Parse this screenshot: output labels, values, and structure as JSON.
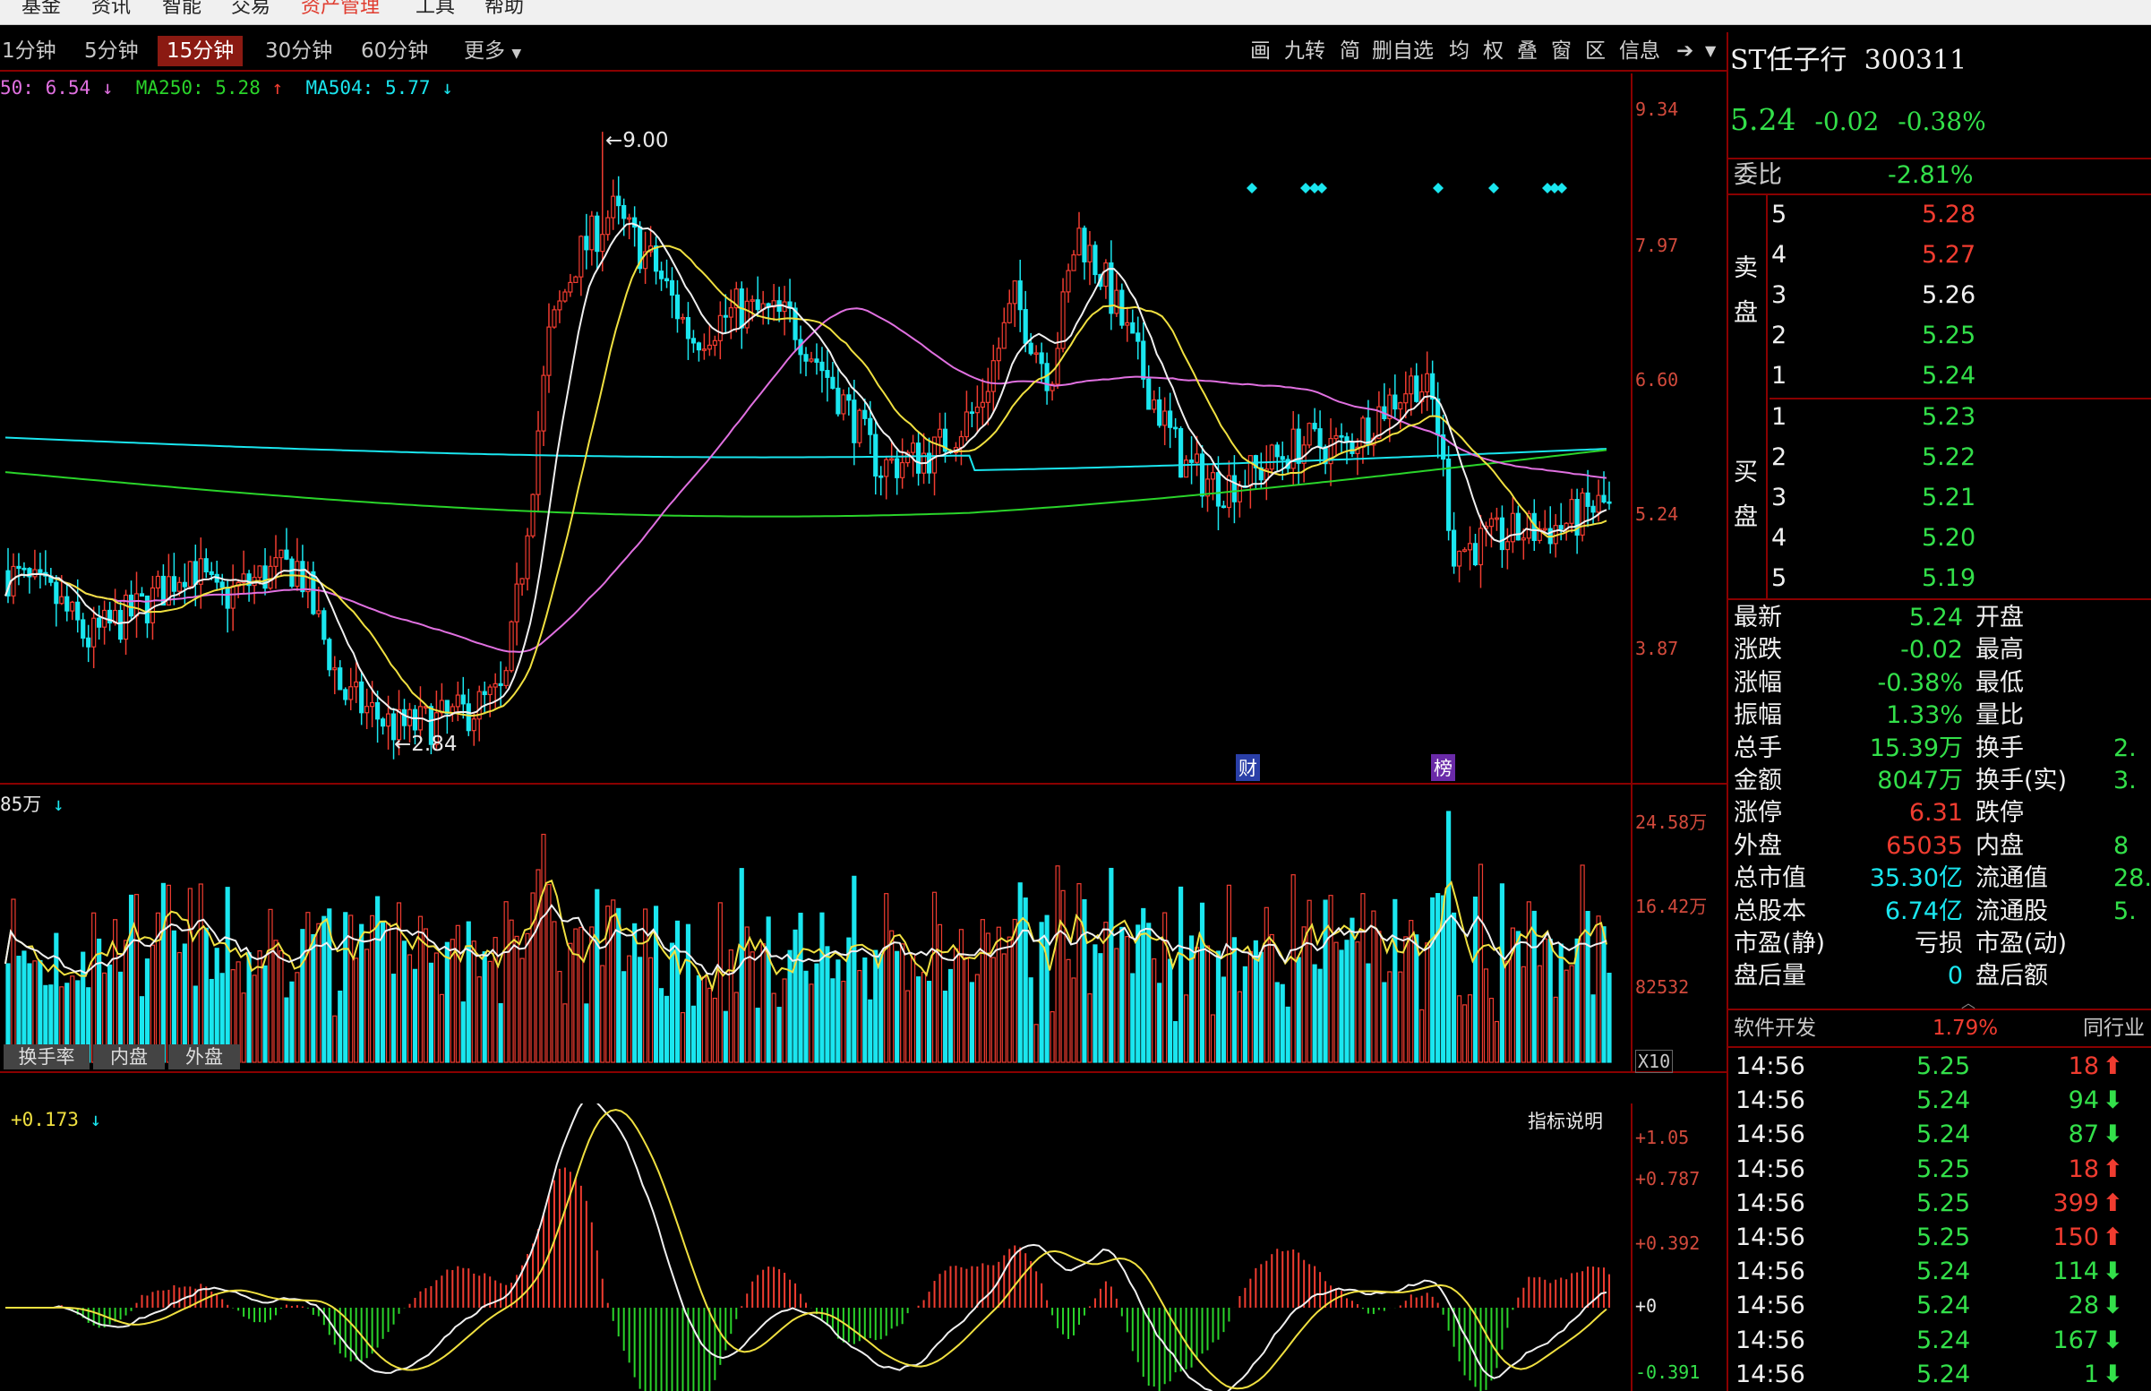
{
  "menu": [
    {
      "label": "基金",
      "active": false
    },
    {
      "label": "资讯",
      "active": false
    },
    {
      "label": "智能",
      "active": false
    },
    {
      "label": "交易",
      "active": false
    },
    {
      "label": "资产管理",
      "active": true
    },
    {
      "label": "工具",
      "active": false
    },
    {
      "label": "帮助",
      "active": false
    }
  ],
  "periods": [
    "1分钟",
    "5分钟",
    "15分钟",
    "30分钟",
    "60分钟",
    "更多"
  ],
  "active_period": "15分钟",
  "tools": [
    "画",
    "九转",
    "简",
    "删自选",
    "均",
    "权",
    "叠",
    "窗",
    "区",
    "信息"
  ],
  "ma_legend": [
    {
      "text": "50: 6.54",
      "arrow": "↓",
      "color": "#e070e0"
    },
    {
      "text": "MA250: 5.28",
      "arrow": "↑",
      "color": "#2ad42a"
    },
    {
      "text": "MA504: 5.77",
      "arrow": "↓",
      "color": "#1ae6ef"
    }
  ],
  "price_axis": [
    "9.34",
    "7.97",
    "6.60",
    "5.24",
    "3.87"
  ],
  "annotations": {
    "high": "9.00",
    "low": "2.84",
    "marker_cai": "财",
    "marker_bang": "榜"
  },
  "volume": {
    "legend": "85万",
    "legend_arrow": "↓",
    "axis": [
      "24.58万",
      "16.42万",
      "82532"
    ],
    "x10": "X10"
  },
  "indicator_tabs": [
    "换手率",
    "内盘",
    "外盘"
  ],
  "indicator": {
    "legend": "+0.173",
    "legend_arrow": "↓",
    "desc_label": "指标说明",
    "axis": [
      "+1.05",
      "+0.787",
      "+0.392",
      "+0",
      "-0.391"
    ]
  },
  "stock": {
    "name": "ST任子行",
    "code": "300311",
    "price": "5.24",
    "change": "-0.02",
    "change_pct": "-0.38%"
  },
  "weibi": {
    "label": "委比",
    "value": "-2.81%"
  },
  "order_book": {
    "sell_label": [
      "卖",
      "盘"
    ],
    "buy_label": [
      "买",
      "盘"
    ],
    "sell": [
      {
        "level": "5",
        "price": "5.28",
        "color": "#f03c30"
      },
      {
        "level": "4",
        "price": "5.27",
        "color": "#f03c30"
      },
      {
        "level": "3",
        "price": "5.26",
        "color": "#f0f0f0"
      },
      {
        "level": "2",
        "price": "5.25",
        "color": "#33e04a"
      },
      {
        "level": "1",
        "price": "5.24",
        "color": "#33e04a"
      }
    ],
    "buy": [
      {
        "level": "1",
        "price": "5.23",
        "color": "#33e04a"
      },
      {
        "level": "2",
        "price": "5.22",
        "color": "#33e04a"
      },
      {
        "level": "3",
        "price": "5.21",
        "color": "#33e04a"
      },
      {
        "level": "4",
        "price": "5.20",
        "color": "#33e04a"
      },
      {
        "level": "5",
        "price": "5.19",
        "color": "#33e04a"
      }
    ]
  },
  "stats": [
    {
      "label": "最新",
      "value": "5.24",
      "color": "#33e04a",
      "label2": "开盘",
      "value2": ""
    },
    {
      "label": "涨跌",
      "value": "-0.02",
      "color": "#33e04a",
      "label2": "最高",
      "value2": ""
    },
    {
      "label": "涨幅",
      "value": "-0.38%",
      "color": "#33e04a",
      "label2": "最低",
      "value2": ""
    },
    {
      "label": "振幅",
      "value": "1.33%",
      "color": "#33e04a",
      "label2": "量比",
      "value2": ""
    },
    {
      "label": "总手",
      "value": "15.39万",
      "color": "#33e04a",
      "label2": "换手",
      "value2": "2."
    },
    {
      "label": "金额",
      "value": "8047万",
      "color": "#33e04a",
      "label2": "换手(实)",
      "value2": "3."
    },
    {
      "label": "涨停",
      "value": "6.31",
      "color": "#f03c30",
      "label2": "跌停",
      "value2": ""
    },
    {
      "label": "外盘",
      "value": "65035",
      "color": "#f03c30",
      "label2": "内盘",
      "value2": "8"
    },
    {
      "label": "总市值",
      "value": "35.30亿",
      "color": "#1ae6ef",
      "label2": "流通值",
      "value2": "28."
    },
    {
      "label": "总股本",
      "value": "6.74亿",
      "color": "#1ae6ef",
      "label2": "流通股",
      "value2": "5."
    },
    {
      "label": "市盈(静)",
      "value": "亏损",
      "color": "#f0f0f0",
      "label2": "市盈(动)",
      "value2": ""
    },
    {
      "label": "盘后量",
      "value": "0",
      "color": "#1ae6ef",
      "label2": "盘后额",
      "value2": ""
    }
  ],
  "industry": {
    "label": "软件开发",
    "pct": "1.79%",
    "peer": "同行业"
  },
  "ticks": [
    {
      "time": "14:56",
      "price": "5.25",
      "vol": "18",
      "dir": "up"
    },
    {
      "time": "14:56",
      "price": "5.24",
      "vol": "94",
      "dir": "down"
    },
    {
      "time": "14:56",
      "price": "5.24",
      "vol": "87",
      "dir": "down"
    },
    {
      "time": "14:56",
      "price": "5.25",
      "vol": "18",
      "dir": "up"
    },
    {
      "time": "14:56",
      "price": "5.25",
      "vol": "399",
      "dir": "up"
    },
    {
      "time": "14:56",
      "price": "5.25",
      "vol": "150",
      "dir": "up"
    },
    {
      "time": "14:56",
      "price": "5.24",
      "vol": "114",
      "dir": "down"
    },
    {
      "time": "14:56",
      "price": "5.24",
      "vol": "28",
      "dir": "down"
    },
    {
      "time": "14:56",
      "price": "5.24",
      "vol": "167",
      "dir": "down"
    },
    {
      "time": "14:56",
      "price": "5.24",
      "vol": "1",
      "dir": "down"
    }
  ],
  "chart_data": {
    "type": "candlestick",
    "price_range": [
      2.84,
      9.34
    ],
    "key_points": [
      {
        "label": "low",
        "value": 2.84
      },
      {
        "label": "high",
        "value": 9.0
      },
      {
        "label": "last",
        "value": 5.24
      }
    ],
    "moving_averages": [
      {
        "name": "MA250",
        "value": 5.28
      },
      {
        "name": "MA504",
        "value": 5.77
      }
    ]
  }
}
